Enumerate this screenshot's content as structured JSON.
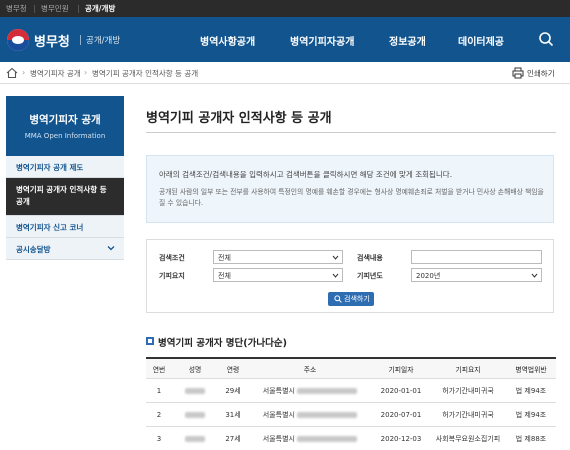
{
  "topbar": {
    "items": [
      "병무청",
      "병무민원",
      "공개/개방"
    ]
  },
  "header": {
    "logo_text": "병무청",
    "logo_sub": "공개/개방",
    "nav": [
      "병역사항공개",
      "병역기피자공개",
      "정보공개",
      "데이터제공"
    ]
  },
  "breadcrumb": {
    "items": [
      "병역기피자 공개",
      "병역기피 공개자 인적사항 등 공개"
    ],
    "print_label": "인쇄하기"
  },
  "sidebar": {
    "title": "병역기피자 공개",
    "subtitle": "MMA Open Information",
    "items": [
      {
        "label": "병역기피자 공개 제도"
      },
      {
        "label": "병역기피 공개자 인적사항 등 공개"
      },
      {
        "label": "병역기피자 신고 코너"
      },
      {
        "label": "공시송달방"
      }
    ]
  },
  "main": {
    "title": "병역기피 공개자 인적사항 등 공개",
    "notice1": "아래의 검색조건/검색내용을 입력하시고 검색버튼을 클릭하시면 해당 조건에 맞게 조회됩니다.",
    "notice2": "공개된 사람의 일부 또는 전부를 사용하여 특정인의 명예를 훼손할 경우에는 형사상 명예훼손죄로 처벌을 받거나 민사상 손해배상 책임을 질 수 있습니다."
  },
  "search": {
    "cond_label": "검색조건",
    "cond_value": "전체",
    "content_label": "검색내용",
    "content_value": "",
    "type_label": "기피요지",
    "type_value": "전체",
    "year_label": "기피년도",
    "year_value": "2020년",
    "button_label": "검색하기"
  },
  "list": {
    "title": "병역기피 공개자 명단(가나다순)",
    "columns": [
      "연번",
      "성명",
      "연령",
      "주소",
      "기피일자",
      "기피요지",
      "병역법위반"
    ],
    "rows": [
      {
        "no": "1",
        "age": "29세",
        "addr_prefix": "서울특별시",
        "date": "2020-01-01",
        "reason": "허가기간내미귀국",
        "law": "법 제94조"
      },
      {
        "no": "2",
        "age": "31세",
        "addr_prefix": "서울특별시",
        "date": "2020-07-01",
        "reason": "허가기간내미귀국",
        "law": "법 제94조"
      },
      {
        "no": "3",
        "age": "27세",
        "addr_prefix": "서울특별시",
        "date": "2020-12-03",
        "reason": "사회복무요원소집기피",
        "law": "법 제88조"
      }
    ]
  },
  "colors": {
    "brand": "#12548e",
    "dark": "#2c2c2c",
    "button": "#2f6db3",
    "notice_bg": "#eef5fb"
  }
}
